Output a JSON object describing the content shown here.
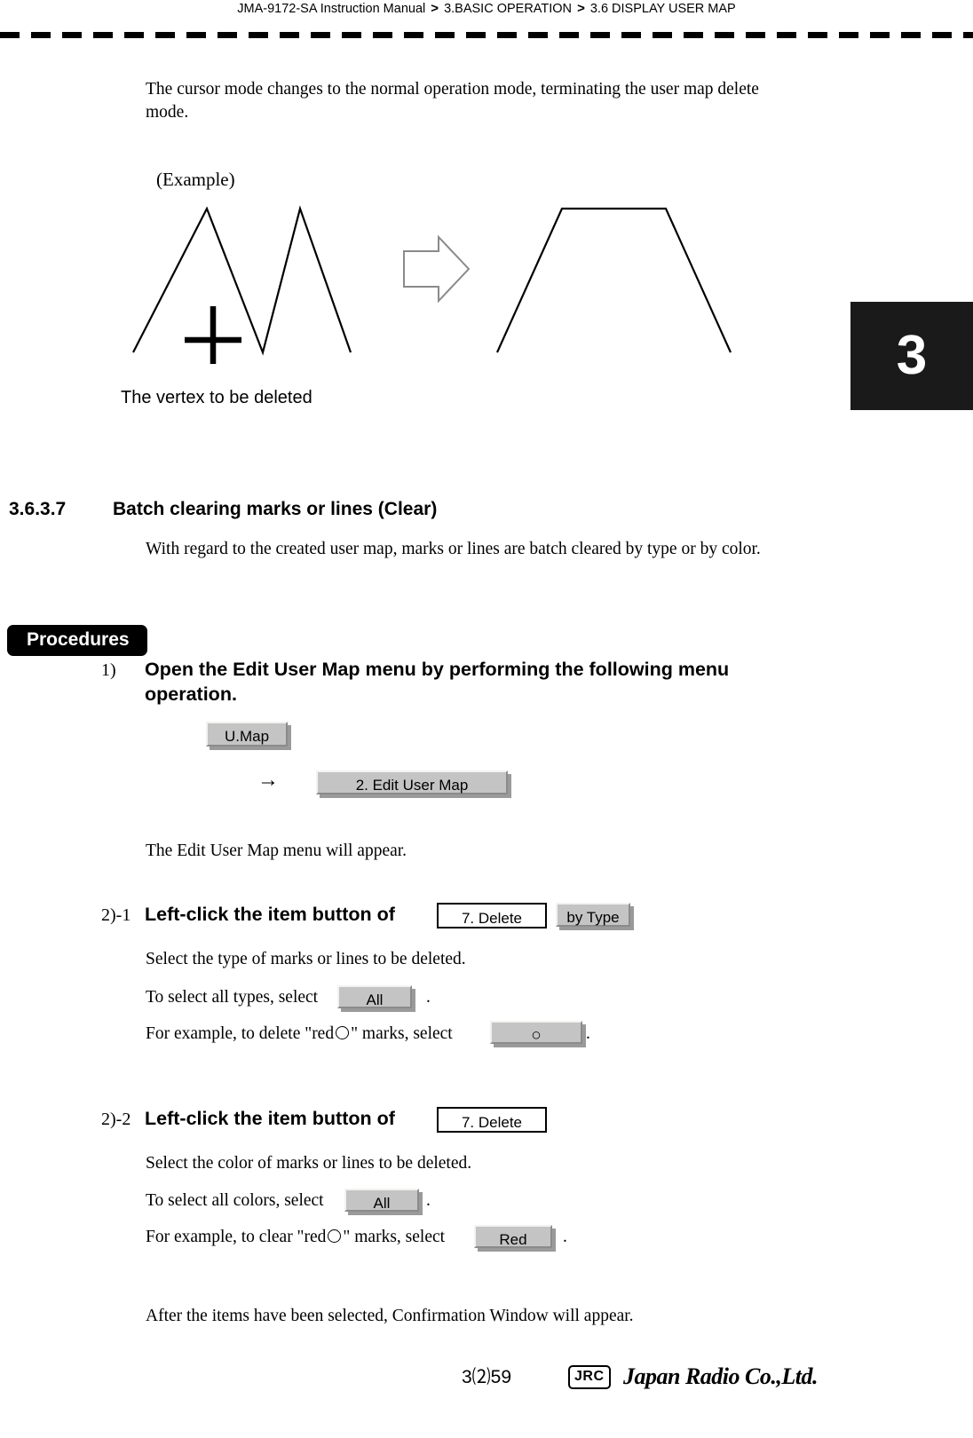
{
  "header": {
    "manual": "JMA-9172-SA Instruction Manual",
    "sep1": ">",
    "chapter": "3.BASIC OPERATION",
    "sep2": ">",
    "section": "3.6  DISPLAY USER MAP"
  },
  "chapter_tab": {
    "number": "3"
  },
  "intro": {
    "paragraph": "The cursor mode changes to the normal operation mode, terminating the user map delete mode."
  },
  "example": {
    "label": "(Example)",
    "caption": "The vertex to be deleted"
  },
  "section_heading": {
    "number": "3.6.3.7",
    "title": "Batch clearing marks or lines (Clear)",
    "description": "With regard to the created user map, marks or lines are batch cleared by type or by color."
  },
  "procedures": {
    "badge": "Procedures"
  },
  "step1": {
    "number": "1)",
    "title": "Open the Edit User Map menu by performing the following menu operation.",
    "button_umap": "U.Map",
    "arrow": "→",
    "button_edit_user_map": "2. Edit User Map",
    "result": "The Edit User Map menu will appear."
  },
  "step2_1": {
    "number": "2)-1",
    "title": "Left-click the item button of",
    "box_delete": "7. Delete",
    "button_by_type": "by Type",
    "line1": "Select the type of marks or lines to be deleted.",
    "line2_pre": "To select all types, select",
    "button_all": "All",
    "line2_post": ".",
    "line3_pre": "For example, to delete \"red",
    "line3_mid": "\" marks, select",
    "button_circle": "○",
    "line3_post": "."
  },
  "step2_2": {
    "number": "2)-2",
    "title": "Left-click the item button of",
    "box_delete": "7. Delete",
    "line1": "Select the color of marks or lines to be deleted.",
    "line2_pre": "To select all colors, select",
    "button_all": "All",
    "line2_post": ".",
    "line3_pre": "For example, to clear \"red",
    "line3_mid": "\" marks, select",
    "button_red": "Red",
    "line3_post": "."
  },
  "closing": {
    "text": "After the items have been selected, Confirmation Window will appear."
  },
  "footer": {
    "page_number": "3⑵59",
    "logo_mark": "JRC",
    "logo_name": "Japan Radio Co.,Ltd."
  },
  "colors": {
    "button_face": "#c4c4c4",
    "button_light": "#f2f2f0",
    "button_dark": "#8b8b8b",
    "tab_black": "#1a1a1a"
  }
}
